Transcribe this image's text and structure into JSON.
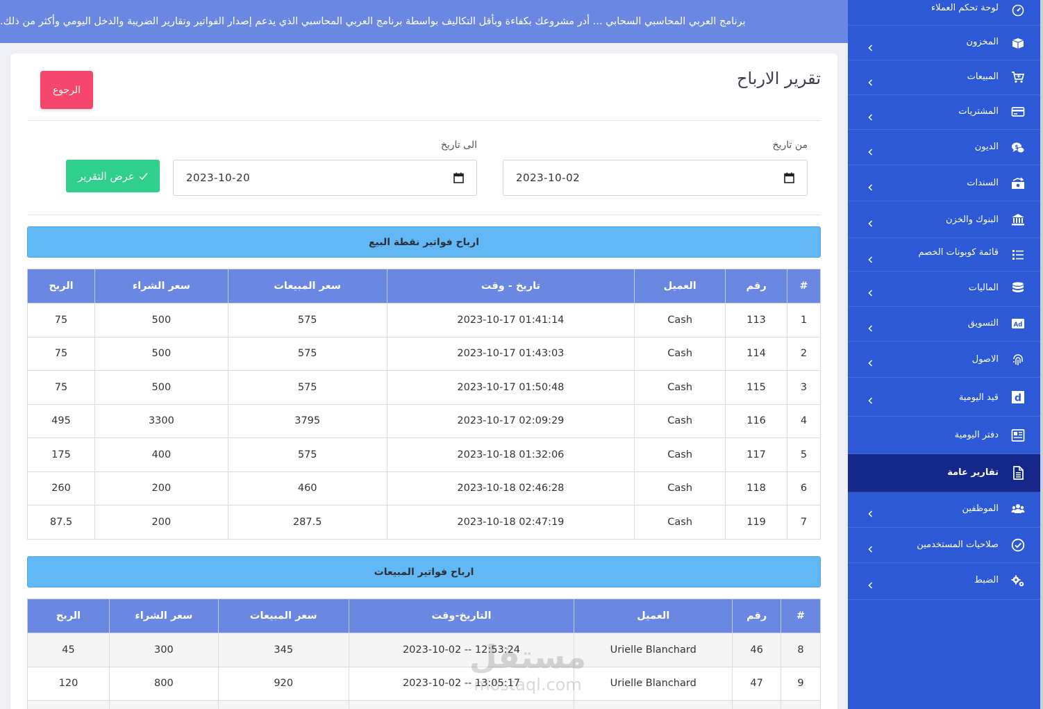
{
  "banner": {
    "text": "برنامج العربي المحاسبي السحابي ... أدر مشروعك بكفاءة وبأقل التكاليف بواسطة برنامج العربي المحاسبي الذي يدعم إصدار الفواتير وتقارير الضريبة والدخل اليومي وأكثر من ذلك."
  },
  "sidebar": {
    "items": [
      {
        "label": "لوحة تحكم العملاء",
        "icon": "dashboard-icon"
      },
      {
        "label": "المخزون",
        "icon": "boxes-icon"
      },
      {
        "label": "المبيعات",
        "icon": "cart-plus-icon"
      },
      {
        "label": "المشتريات",
        "icon": "credit-card-icon"
      },
      {
        "label": "الديون",
        "icon": "comments-dollar-icon"
      },
      {
        "label": "السندات",
        "icon": "money-bills-icon"
      },
      {
        "label": "البنوك والخزن",
        "icon": "bank-icon"
      },
      {
        "label": "قائمة كوبونات الخصم",
        "icon": "list-icon"
      },
      {
        "label": "الماليات",
        "icon": "coins-icon"
      },
      {
        "label": "التسويق",
        "icon": "ad-icon"
      },
      {
        "label": "الاصول",
        "icon": "fingerprint-icon"
      },
      {
        "label": "قيد اليومية",
        "icon": "letter-d-icon"
      },
      {
        "label": "دفتر اليومية",
        "icon": "newspaper-icon"
      },
      {
        "label": "تقارير عامة",
        "icon": "file-report-icon"
      },
      {
        "label": "الموظفين",
        "icon": "users-icon"
      },
      {
        "label": "صلاحيات المستخدمين",
        "icon": "check-circle-icon"
      },
      {
        "label": "الضبط",
        "icon": "cogs-icon"
      }
    ]
  },
  "page": {
    "title": "تقرير الارباح",
    "back_label": "الرجوع"
  },
  "filters": {
    "from_label": "من تاريخ",
    "from_value": "2023-10-02",
    "to_label": "الى تاريخ",
    "to_value": "2023-10-20",
    "show_label": "عرض التقرير"
  },
  "pos_section": {
    "title": "ارباح فواتير نقطة البيع",
    "headers": [
      "#",
      "رقم",
      "العميل",
      "تاريخ - وقت",
      "سعر المبيعات",
      "سعر الشراء",
      "الربح"
    ],
    "rows": [
      [
        "1",
        "113",
        "Cash",
        "2023-10-17 01:41:14",
        "575",
        "500",
        "75"
      ],
      [
        "2",
        "114",
        "Cash",
        "2023-10-17 01:43:03",
        "575",
        "500",
        "75"
      ],
      [
        "3",
        "115",
        "Cash",
        "2023-10-17 01:50:48",
        "575",
        "500",
        "75"
      ],
      [
        "4",
        "116",
        "Cash",
        "2023-10-17 02:09:29",
        "3795",
        "3300",
        "495"
      ],
      [
        "5",
        "117",
        "Cash",
        "2023-10-18 01:32:06",
        "575",
        "400",
        "175"
      ],
      [
        "6",
        "118",
        "Cash",
        "2023-10-18 02:46:28",
        "460",
        "200",
        "260"
      ],
      [
        "7",
        "119",
        "Cash",
        "2023-10-18 02:47:19",
        "287.5",
        "200",
        "87.5"
      ]
    ]
  },
  "sales_section": {
    "title": "ارباح فواتير المبيعات",
    "headers": [
      "#",
      "رقم",
      "العميل",
      "التاريخ-وقت",
      "سعر المبيعات",
      "سعر الشراء",
      "الربح"
    ],
    "rows": [
      [
        "8",
        "46",
        "Urielle Blanchard",
        "2023-10-02 -- 12:53:24",
        "345",
        "300",
        "45"
      ],
      [
        "9",
        "47",
        "Urielle Blanchard",
        "2023-10-02 -- 13:05:17",
        "920",
        "800",
        "120"
      ]
    ]
  },
  "watermark": {
    "arabic": "مستقل",
    "latin": "mostaql.com"
  },
  "colors": {
    "sidebar_bg": "#2d59d6",
    "sidebar_active": "#16278a",
    "banner_bg": "#6a88e2",
    "table_header": "#6a88e2",
    "section_header": "#62b8f5",
    "back_button": "#f4476b",
    "show_button": "#2fcf8c"
  }
}
